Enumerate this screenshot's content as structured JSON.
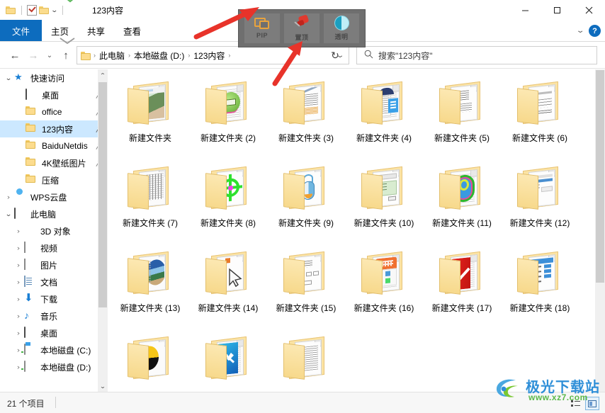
{
  "window": {
    "title": "123内容",
    "quick_access_icons": [
      "folder-icon",
      "properties-icon",
      "new-folder-icon",
      "customize-caret-icon"
    ],
    "controls": {
      "minimize": "—",
      "maximize": "▢",
      "close": "✕"
    }
  },
  "ribbon": {
    "tabs": [
      {
        "label": "文件",
        "active": true
      },
      {
        "label": "主页",
        "active": false
      },
      {
        "label": "共享",
        "active": false
      },
      {
        "label": "查看",
        "active": false
      }
    ],
    "expand_label": "⌄",
    "help_label": "?"
  },
  "addressbar": {
    "back": "←",
    "forward": "→",
    "recent": "⌄",
    "up": "↑",
    "crumbs": [
      "此电脑",
      "本地磁盘 (D:)",
      "123内容"
    ],
    "crumb_separator": "›",
    "dropdown": "⌄",
    "refresh": "↻"
  },
  "search": {
    "placeholder": "搜索\"123内容\"",
    "icon": "search-icon"
  },
  "sidebar": {
    "groups": [
      {
        "label": "快速访问",
        "icon": "quick-access-star-icon",
        "expanded": true,
        "items": [
          {
            "label": "桌面",
            "icon": "desktop-icon",
            "pinned": true,
            "selected": false
          },
          {
            "label": "office",
            "icon": "folder-icon",
            "pinned": true,
            "selected": false
          },
          {
            "label": "123内容",
            "icon": "folder-icon",
            "pinned": true,
            "selected": true
          },
          {
            "label": "BaiduNetdis",
            "icon": "folder-icon",
            "pinned": true,
            "selected": false
          },
          {
            "label": "4K壁纸图片",
            "icon": "folder-icon",
            "pinned": true,
            "selected": false
          },
          {
            "label": "压缩",
            "icon": "folder-icon",
            "pinned": false,
            "selected": false
          }
        ]
      },
      {
        "label": "WPS云盘",
        "icon": "cloud-icon",
        "expanded": false,
        "items": []
      },
      {
        "label": "此电脑",
        "icon": "this-pc-icon",
        "expanded": true,
        "items": [
          {
            "label": "3D 对象",
            "icon": "cube-icon"
          },
          {
            "label": "视频",
            "icon": "video-icon"
          },
          {
            "label": "图片",
            "icon": "pictures-icon"
          },
          {
            "label": "文档",
            "icon": "documents-icon"
          },
          {
            "label": "下载",
            "icon": "downloads-icon"
          },
          {
            "label": "音乐",
            "icon": "music-icon"
          },
          {
            "label": "桌面",
            "icon": "desktop-icon"
          },
          {
            "label": "本地磁盘 (C:)",
            "icon": "system-drive-icon"
          },
          {
            "label": "本地磁盘 (D:)",
            "icon": "drive-icon"
          }
        ]
      }
    ]
  },
  "content": {
    "items": [
      {
        "label": "新建文件夹",
        "art": "photo"
      },
      {
        "label": "新建文件夹 (2)",
        "art": "green-keyboard"
      },
      {
        "label": "新建文件夹 (3)",
        "art": "pencil-doc"
      },
      {
        "label": "新建文件夹 (4)",
        "art": "blue-doc"
      },
      {
        "label": "新建文件夹 (5)",
        "art": "text-list"
      },
      {
        "label": "新建文件夹 (6)",
        "art": "text-doc"
      },
      {
        "label": "新建文件夹 (7)",
        "art": "table-grid"
      },
      {
        "label": "新建文件夹 (8)",
        "art": "green-target"
      },
      {
        "label": "新建文件夹 (9)",
        "art": "blue-mouse"
      },
      {
        "label": "新建文件夹 (10)",
        "art": "green-dialog"
      },
      {
        "label": "新建文件夹 (11)",
        "art": "blue-oval"
      },
      {
        "label": "新建文件夹 (12)",
        "art": "window-dialog"
      },
      {
        "label": "新建文件夹 (13)",
        "art": "globe-photo"
      },
      {
        "label": "新建文件夹 (14)",
        "art": "cursor-doc"
      },
      {
        "label": "新建文件夹 (15)",
        "art": "form-doc"
      },
      {
        "label": "新建文件夹 (16)",
        "art": "orange-app"
      },
      {
        "label": "新建文件夹 (17)",
        "art": "red-check"
      },
      {
        "label": "新建文件夹 (18)",
        "art": "blue-list"
      },
      {
        "label": "",
        "art": "yellow-fan"
      },
      {
        "label": "",
        "art": "blue-tools"
      },
      {
        "label": "",
        "art": "plain-doc"
      }
    ]
  },
  "overlay_toolbar": {
    "buttons": [
      {
        "label": "PIP",
        "icon": "pip-icon"
      },
      {
        "label": "置顶",
        "icon": "pushpin-icon"
      },
      {
        "label": "透明",
        "icon": "transparency-icon"
      }
    ]
  },
  "statusbar": {
    "item_count": "21 个项目",
    "views": [
      "details-view-icon",
      "large-icons-view-icon"
    ]
  },
  "watermark": {
    "name": "极光下载站",
    "url": "www.xz7.com"
  },
  "colors": {
    "accent": "#0d6cbe",
    "selection": "#cce8ff",
    "folder": "#fbdc8d",
    "arrow_red": "#e8332a",
    "overlay_bg": "#6f6f6f",
    "watermark_blue": "#2f8fd8",
    "watermark_green": "#5ab84a"
  }
}
